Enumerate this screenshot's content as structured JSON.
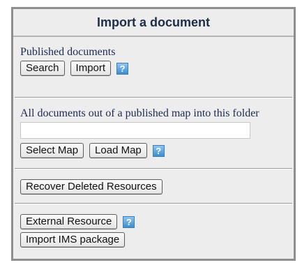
{
  "header": {
    "title": "Import a document"
  },
  "published": {
    "label": "Published documents",
    "search_button": "Search",
    "import_button": "Import",
    "help_glyph": "?"
  },
  "map": {
    "label": "All documents out of a published map into this folder",
    "input_value": "",
    "input_placeholder": "",
    "select_map_button": "Select Map",
    "load_map_button": "Load Map",
    "help_glyph": "?"
  },
  "recover": {
    "button": "Recover Deleted Resources"
  },
  "external": {
    "external_resource_button": "External Resource",
    "help_glyph": "?",
    "import_ims_button": "Import IMS package"
  },
  "colors": {
    "panel_background": "#ededed",
    "panel_border": "#8f8f8f",
    "title_text": "#1e2d4a",
    "label_text": "#1c2a52",
    "help_icon": "#3d8dd0"
  }
}
